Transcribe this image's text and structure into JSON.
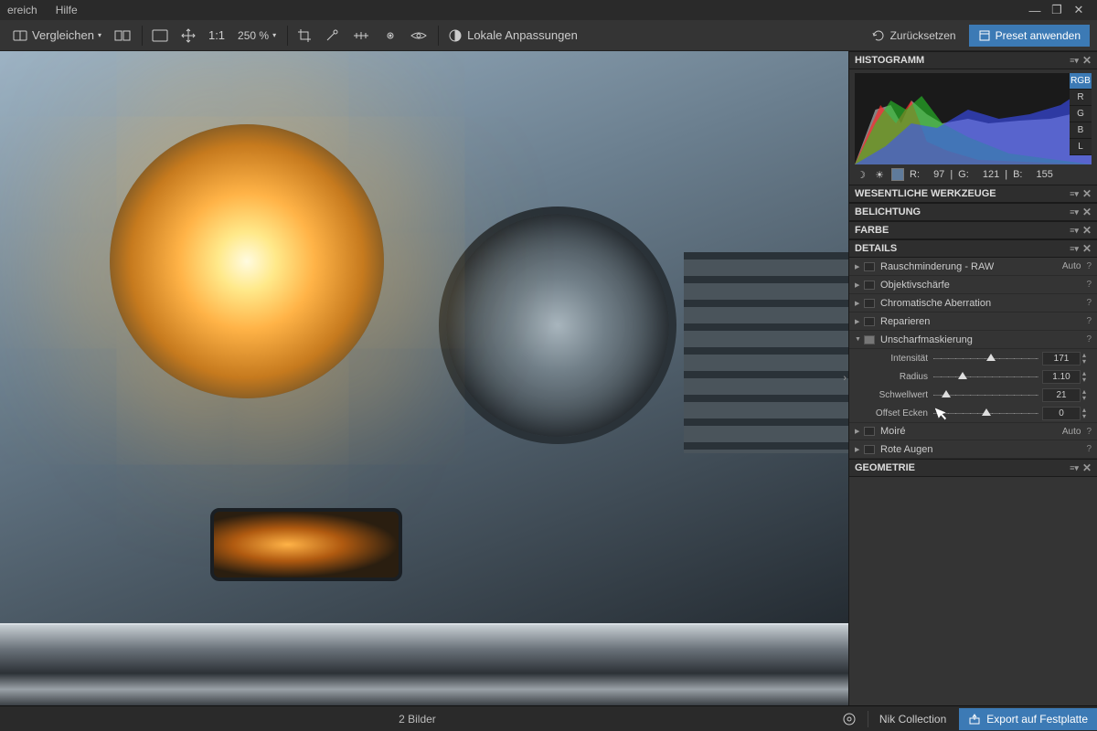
{
  "menu": {
    "item1": "ereich",
    "item2": "Hilfe"
  },
  "toolbar": {
    "compare": "Vergleichen",
    "oneToOne": "1:1",
    "zoom": "250 %",
    "localAdjust": "Lokale Anpassungen",
    "reset": "Zurücksetzen",
    "applyPreset": "Preset anwenden"
  },
  "histogram": {
    "title": "HISTOGRAMM",
    "tabs": [
      "RGB",
      "R",
      "G",
      "B",
      "L"
    ],
    "readout": {
      "r": "97",
      "g": "121",
      "b": "155",
      "rLabel": "R:",
      "gLabel": "G:",
      "bLabel": "B:"
    }
  },
  "sections": {
    "tools": "WESENTLICHE WERKZEUGE",
    "exposure": "BELICHTUNG",
    "color": "FARBE",
    "details": "DETAILS",
    "geometry": "GEOMETRIE"
  },
  "details": {
    "noise": {
      "label": "Rauschminderung - RAW",
      "auto": "Auto"
    },
    "lens": {
      "label": "Objektivschärfe"
    },
    "ca": {
      "label": "Chromatische Aberration"
    },
    "repair": {
      "label": "Reparieren"
    },
    "usm": {
      "label": "Unscharfmaskierung",
      "intensity": {
        "label": "Intensität",
        "value": "171",
        "pos": 55
      },
      "radius": {
        "label": "Radius",
        "value": "1.10",
        "pos": 28
      },
      "threshold": {
        "label": "Schwellwert",
        "value": "21",
        "pos": 12
      },
      "offset": {
        "label": "Offset Ecken",
        "value": "0",
        "pos": 50
      }
    },
    "moire": {
      "label": "Moiré",
      "auto": "Auto"
    },
    "redeye": {
      "label": "Rote Augen"
    }
  },
  "status": {
    "counter": "2 Bilder",
    "nik": "Nik Collection",
    "export": "Export auf Festplatte"
  }
}
